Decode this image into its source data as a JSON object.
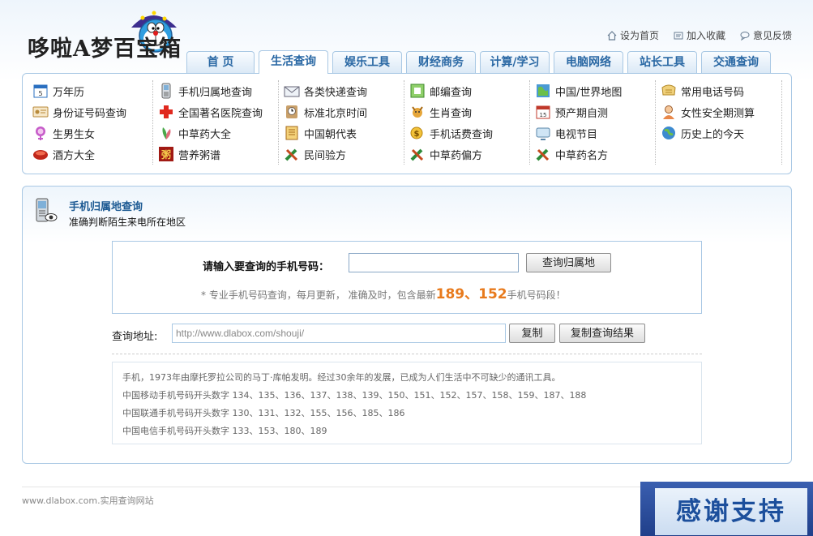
{
  "logo": {
    "text": "哆啦A梦百宝箱"
  },
  "top_links": [
    {
      "label": "设为首页",
      "icon": "home-icon"
    },
    {
      "label": "加入收藏",
      "icon": "bookmark-icon"
    },
    {
      "label": "意见反馈",
      "icon": "feedback-icon"
    }
  ],
  "tabs": [
    {
      "label": "首 页",
      "active": false
    },
    {
      "label": "生活查询",
      "active": true
    },
    {
      "label": "娱乐工具",
      "active": false
    },
    {
      "label": "财经商务",
      "active": false
    },
    {
      "label": "计算/学习",
      "active": false
    },
    {
      "label": "电脑网络",
      "active": false
    },
    {
      "label": "站长工具",
      "active": false
    },
    {
      "label": "交通查询",
      "active": false
    }
  ],
  "nav_columns": [
    [
      {
        "label": "万年历",
        "icon": "calendar-icon"
      },
      {
        "label": "身份证号码查询",
        "icon": "id-card-icon"
      },
      {
        "label": "生男生女",
        "icon": "baby-icon"
      },
      {
        "label": "酒方大全",
        "icon": "wine-icon"
      }
    ],
    [
      {
        "label": "手机归属地查询",
        "icon": "mobile-icon"
      },
      {
        "label": "全国著名医院查询",
        "icon": "hospital-icon"
      },
      {
        "label": "中草药大全",
        "icon": "herb-icon"
      },
      {
        "label": "营养粥谱",
        "icon": "porridge-icon"
      }
    ],
    [
      {
        "label": "各类快递查询",
        "icon": "mail-icon"
      },
      {
        "label": "标准北京时间",
        "icon": "clock-icon"
      },
      {
        "label": "中国朝代表",
        "icon": "scroll-icon"
      },
      {
        "label": "民间验方",
        "icon": "remedy-icon"
      }
    ],
    [
      {
        "label": "邮编查询",
        "icon": "postcode-icon"
      },
      {
        "label": "生肖查询",
        "icon": "zodiac-icon"
      },
      {
        "label": "手机话费查询",
        "icon": "phone-bill-icon"
      },
      {
        "label": "中草药偏方",
        "icon": "remedy-icon"
      }
    ],
    [
      {
        "label": "中国/世界地图",
        "icon": "map-icon"
      },
      {
        "label": "预产期自测",
        "icon": "due-date-icon"
      },
      {
        "label": "电视节目",
        "icon": "tv-icon"
      },
      {
        "label": "中草药名方",
        "icon": "remedy-icon"
      }
    ],
    [
      {
        "label": "常用电话号码",
        "icon": "phonebook-icon"
      },
      {
        "label": "女性安全期测算",
        "icon": "woman-icon"
      },
      {
        "label": "历史上的今天",
        "icon": "globe-icon"
      }
    ]
  ],
  "section": {
    "title": "手机归属地查询",
    "subtitle": "准确判断陌生来电所在地区"
  },
  "query": {
    "label": "请输入要查询的手机号码：",
    "input_value": "",
    "button": "查询归属地",
    "note_prefix": "* 专业手机号码查询，每月更新， 准确及时，包含最新",
    "note_num1": "189",
    "note_sep": "、",
    "note_num2": "152",
    "note_suffix": "手机号码段！"
  },
  "url": {
    "label": "查询地址:",
    "value": "http://www.dlabox.com/shouji/",
    "copy_button": "复制",
    "copy_result_button": "复制查询结果"
  },
  "info": [
    "手机，1973年由摩托罗拉公司的马丁·库帕发明。经过30余年的发展，已成为人们生活中不可缺少的通讯工具。",
    "中国移动手机号码开头数字 134、135、136、137、138、139、150、151、152、157、158、159、187、188",
    "中国联通手机号码开头数字 130、131、132、155、156、185、186",
    "中国电信手机号码开头数字 133、153、180、189"
  ],
  "footer": {
    "text": "www.dlabox.com.实用查询网站"
  },
  "thanks": {
    "text": "感谢支持"
  },
  "colors": {
    "accent": "#2a68a4",
    "border": "#a9c8e4",
    "highlight": "#e87a1c"
  }
}
